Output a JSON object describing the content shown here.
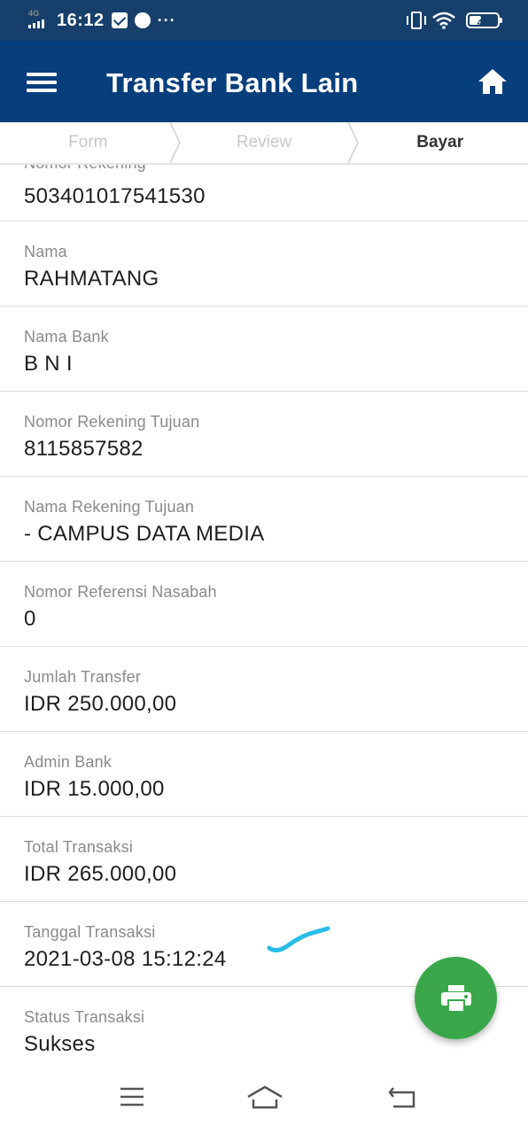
{
  "status_bar": {
    "network": "4G",
    "time": "16:12",
    "overflow": "···",
    "battery": "44",
    "battery_level": 0.44
  },
  "app_bar": {
    "title": "Transfer Bank Lain",
    "menu_icon": "hamburger-menu-icon",
    "home_icon": "home-icon"
  },
  "steps": [
    {
      "label": "Form",
      "active": false
    },
    {
      "label": "Review",
      "active": false
    },
    {
      "label": "Bayar",
      "active": true
    }
  ],
  "details": [
    {
      "label": "Nomor Rekening",
      "value": "503401017541530"
    },
    {
      "label": "Nama",
      "value": "RAHMATANG"
    },
    {
      "label": "Nama Bank",
      "value": "B N I"
    },
    {
      "label": "Nomor Rekening Tujuan",
      "value": "8115857582"
    },
    {
      "label": "Nama Rekening Tujuan",
      "value": "- CAMPUS DATA MEDIA"
    },
    {
      "label": "Nomor Referensi Nasabah",
      "value": "0"
    },
    {
      "label": "Jumlah Transfer",
      "value": "IDR 250.000,00"
    },
    {
      "label": "Admin Bank",
      "value": "IDR 15.000,00"
    },
    {
      "label": "Total Transaksi",
      "value": "IDR 265.000,00"
    },
    {
      "label": "Tanggal Transaksi",
      "value": "2021-03-08 15:12:24"
    },
    {
      "label": "Status Transaksi",
      "value": "Sukses"
    }
  ],
  "fab": {
    "icon": "printer-icon",
    "color": "#3aa84a"
  },
  "colors": {
    "app_bar": "#073e7c",
    "status_bar": "#173f6b",
    "scribble": "#29bde8"
  }
}
